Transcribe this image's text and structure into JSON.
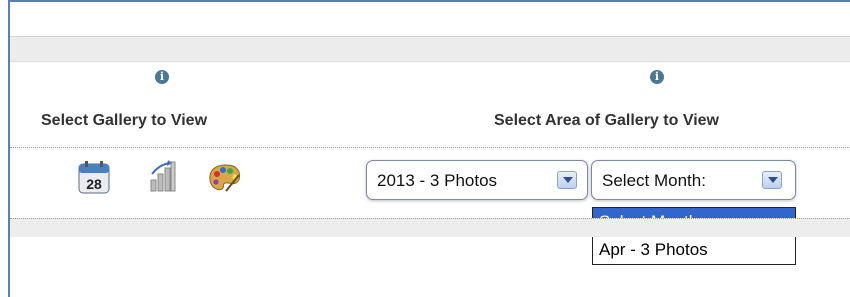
{
  "headings": {
    "gallery": "Select Gallery to View",
    "area": "Select Area of Gallery to View"
  },
  "info_icon_glyph": "i",
  "icons": {
    "calendar": {
      "name": "calendar-icon",
      "day": "28"
    },
    "bars": {
      "name": "bar-chart-icon"
    },
    "palette": {
      "name": "paint-palette-icon"
    }
  },
  "year_select": {
    "value": "2013 - 3 Photos"
  },
  "month_select": {
    "value": "Select Month:",
    "options": [
      "Select Month:",
      "Apr - 3 Photos"
    ],
    "highlighted_index": 0
  },
  "colors": {
    "frame": "#5b7fb5",
    "highlight": "#3166cf",
    "info": "#4d7894"
  }
}
